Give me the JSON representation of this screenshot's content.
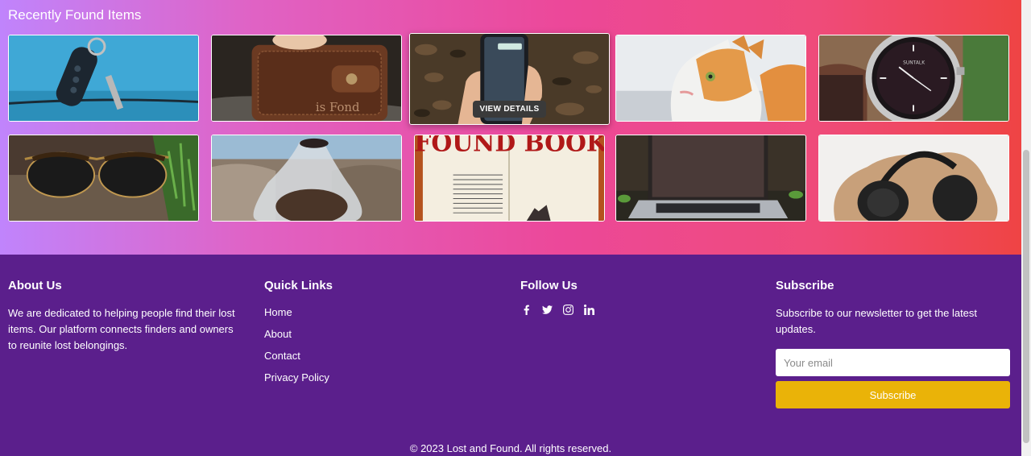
{
  "gallery": {
    "title": "Recently Found Items",
    "view_details_label": "VIEW DETAILS",
    "items": [
      {
        "name": "car-keys-photo"
      },
      {
        "name": "wallet-photo",
        "caption": "is Fond"
      },
      {
        "name": "smartphone-photo"
      },
      {
        "name": "cat-photo"
      },
      {
        "name": "wristwatch-photo",
        "caption": "SUNTALK"
      },
      {
        "name": "sunglasses-photo"
      },
      {
        "name": "plastic-bag-photo"
      },
      {
        "name": "book-photo",
        "caption": "FOUND BOOK"
      },
      {
        "name": "laptop-photo"
      },
      {
        "name": "headphones-photo"
      }
    ]
  },
  "footer": {
    "about": {
      "title": "About Us",
      "text": "We are dedicated to helping people find their lost items. Our platform connects finders and owners to reunite lost belongings."
    },
    "quick_links": {
      "title": "Quick Links",
      "links": [
        "Home",
        "About",
        "Contact",
        "Privacy Policy"
      ]
    },
    "follow": {
      "title": "Follow Us",
      "icons": [
        "facebook-icon",
        "twitter-icon",
        "instagram-icon",
        "linkedin-icon"
      ]
    },
    "subscribe": {
      "title": "Subscribe",
      "text": "Subscribe to our newsletter to get the latest updates.",
      "placeholder": "Your email",
      "button_label": "Subscribe"
    },
    "copyright": "© 2023 Lost and Found. All rights reserved."
  },
  "colors": {
    "footer_bg": "#5b1f8c",
    "subscribe_button": "#eab308"
  }
}
